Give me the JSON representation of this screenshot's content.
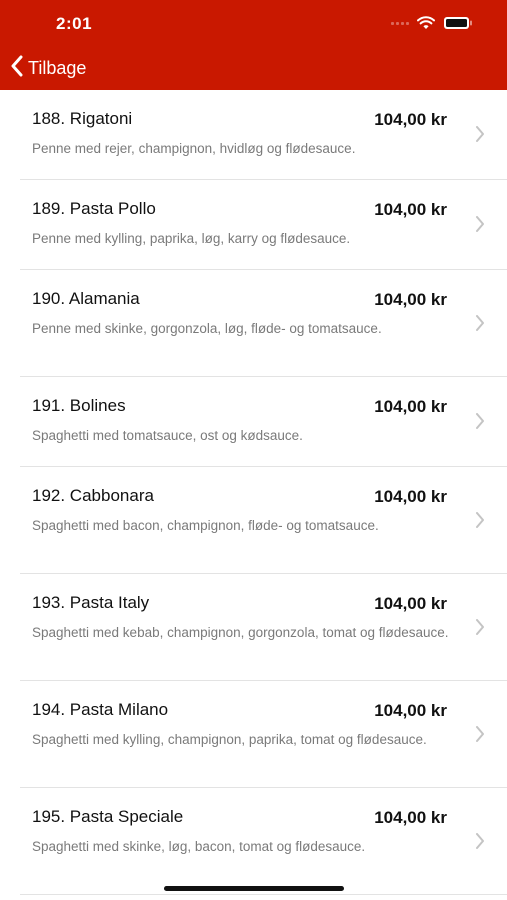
{
  "status_bar": {
    "time": "2:01"
  },
  "nav": {
    "back_label": "Tilbage"
  },
  "items": [
    {
      "name": "188. Rigatoni",
      "price": "104,00 kr",
      "description": "Penne med rejer, champignon, hvidløg og flødesauce."
    },
    {
      "name": "189. Pasta Pollo",
      "price": "104,00 kr",
      "description": "Penne med kylling, paprika, løg, karry og flødesauce."
    },
    {
      "name": "190. Alamania",
      "price": "104,00 kr",
      "description": "Penne med skinke, gorgonzola, løg, fløde- og tomatsauce."
    },
    {
      "name": "191. Bolines",
      "price": "104,00 kr",
      "description": "Spaghetti med tomatsauce, ost og kødsauce."
    },
    {
      "name": "192. Cabbonara",
      "price": "104,00 kr",
      "description": "Spaghetti med bacon, champignon, fløde- og tomatsauce."
    },
    {
      "name": "193. Pasta Italy",
      "price": "104,00 kr",
      "description": "Spaghetti med kebab, champignon, gorgonzola, tomat og flødesauce."
    },
    {
      "name": "194. Pasta Milano",
      "price": "104,00 kr",
      "description": "Spaghetti med kylling, champignon, paprika, tomat og flødesauce."
    },
    {
      "name": "195. Pasta Speciale",
      "price": "104,00 kr",
      "description": "Spaghetti med skinke, løg, bacon, tomat og flødesauce."
    }
  ],
  "icons": {
    "back": "chevron-left-icon",
    "row": "chevron-right-icon",
    "wifi": "wifi-icon",
    "battery": "battery-icon"
  },
  "colors": {
    "header": "#c91800",
    "text": "#111111",
    "description": "#7a7a7a",
    "chevron": "#c4c4c4",
    "separator": "#e3e3e3"
  }
}
